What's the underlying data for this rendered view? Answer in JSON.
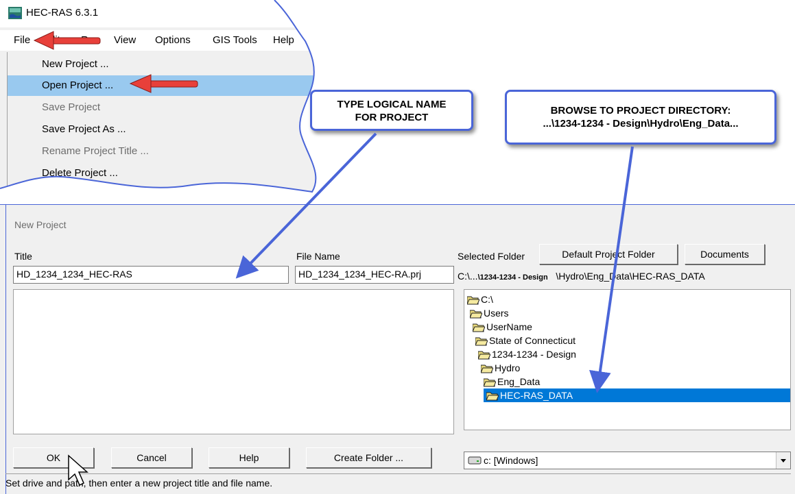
{
  "app": {
    "title": "HEC-RAS 6.3.1",
    "menu": [
      "File",
      "Edit",
      "Run",
      "View",
      "Options",
      "GIS Tools",
      "Help"
    ],
    "file_menu": [
      {
        "label": "New Project ...",
        "state": "enabled"
      },
      {
        "label": "Open Project ...",
        "state": "highlighted"
      },
      {
        "label": "Save Project",
        "state": "disabled"
      },
      {
        "label": "Save Project As ...",
        "state": "enabled"
      },
      {
        "label": "Rename Project Title ...",
        "state": "disabled"
      },
      {
        "label": "Delete Project ...",
        "state": "enabled"
      }
    ]
  },
  "dialog": {
    "title": "New Project",
    "title_label": "Title",
    "title_value": "HD_1234_1234_HEC-RAS",
    "filename_label": "File Name",
    "filename_value": "HD_1234_1234_HEC-RA.prj",
    "selected_folder_label": "Selected Folder",
    "default_folder_button": "Default Project Folder",
    "documents_button": "Documents",
    "path_part1": "C:\\...",
    "path_part2": "\\1234-1234 - Design",
    "path_part3": "\\Hydro\\Eng_Data\\HEC-RAS_DATA",
    "tree": [
      "C:\\",
      "Users",
      "UserName",
      "State of Connecticut",
      "1234-1234 - Design",
      "Hydro",
      "Eng_Data",
      "HEC-RAS_DATA"
    ],
    "selected_tree_item": "HEC-RAS_DATA",
    "buttons": {
      "ok": "OK",
      "cancel": "Cancel",
      "help": "Help",
      "create_folder": "Create Folder ..."
    },
    "drive": "c: [Windows]",
    "status": "Set drive and path, then enter a new project title and file name."
  },
  "callouts": {
    "logical_name_line1": "TYPE LOGICAL NAME",
    "logical_name_line2": "FOR PROJECT",
    "browse_line1": "BROWSE TO PROJECT DIRECTORY:",
    "browse_line2": "...\\1234-1234 - Design\\Hydro\\Eng_Data..."
  },
  "colors": {
    "callout_border": "#4a65d8",
    "red_arrow": "#e8403a",
    "selection": "#0078d7",
    "menu_highlight": "#99c9ef"
  }
}
